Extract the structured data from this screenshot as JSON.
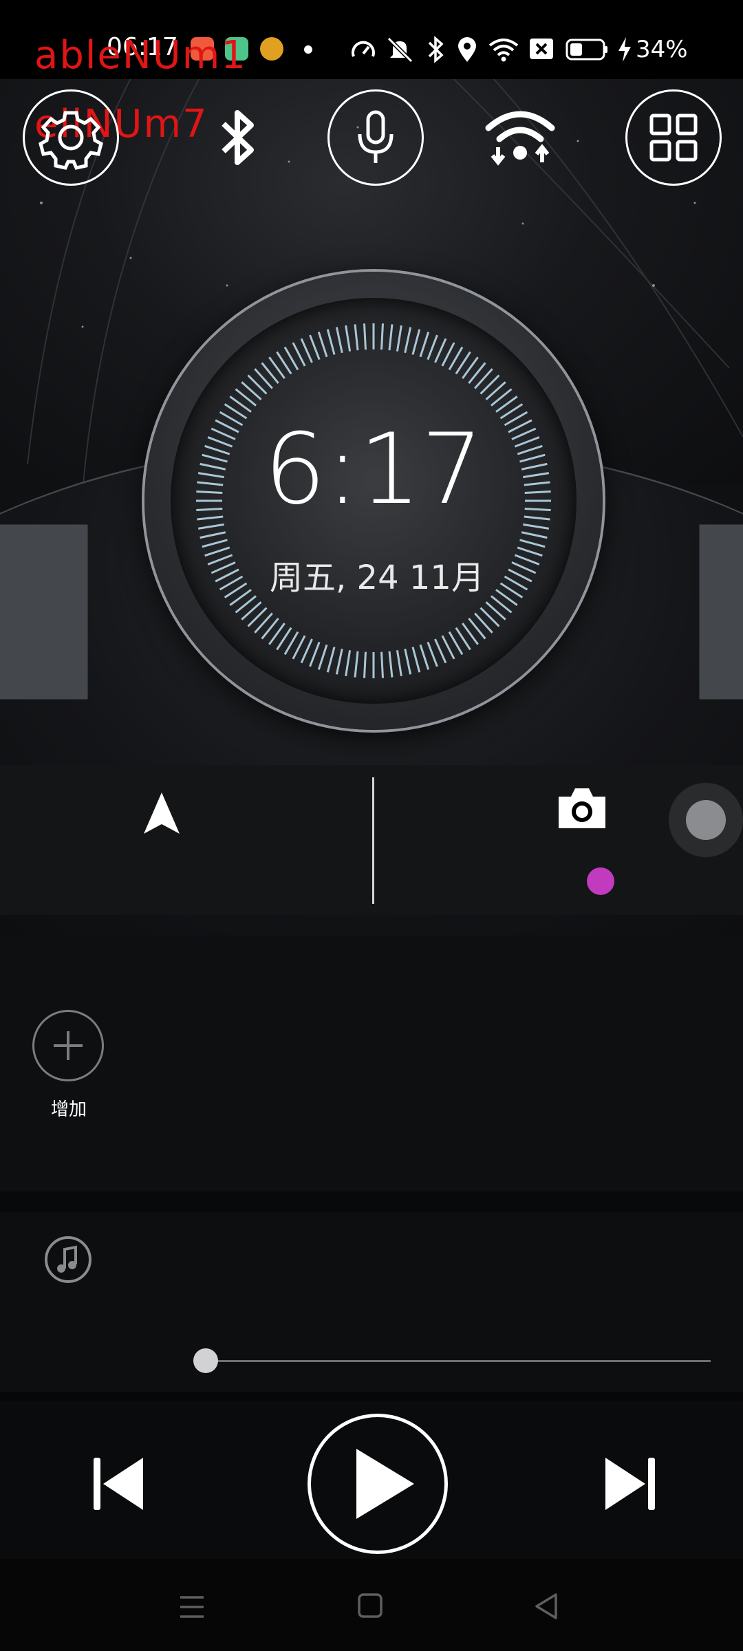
{
  "status_bar": {
    "time": "06:17",
    "battery_percent_text": "34%",
    "icons": [
      "app-icon-1",
      "app-icon-2",
      "app-icon-3",
      "notification-dot",
      "data-saver-icon",
      "mute-icon",
      "bluetooth-icon",
      "location-icon",
      "wifi-icon",
      "sim-x-icon",
      "battery-icon",
      "charging-icon"
    ]
  },
  "overlay": {
    "line1": "ableNUm1",
    "line2": "ellNUm7"
  },
  "quick_buttons": {
    "icons": [
      "settings-icon",
      "bluetooth-icon",
      "microphone-icon",
      "wifi-icon",
      "apps-grid-icon"
    ]
  },
  "clock": {
    "time": "6:17",
    "date": "周五, 24 11月"
  },
  "shortcuts": {
    "icons": [
      "navigation-icon",
      "camera-icon"
    ],
    "accent_dot_color": "#c23bbf"
  },
  "widget": {
    "add_label": "增加"
  },
  "music": {
    "icon": "music-note-icon",
    "progress": 0.0
  },
  "controls": {
    "icons": [
      "previous-icon",
      "play-icon",
      "next-icon"
    ]
  },
  "navbar": {
    "icons": [
      "menu-icon",
      "home-icon",
      "back-icon"
    ]
  }
}
